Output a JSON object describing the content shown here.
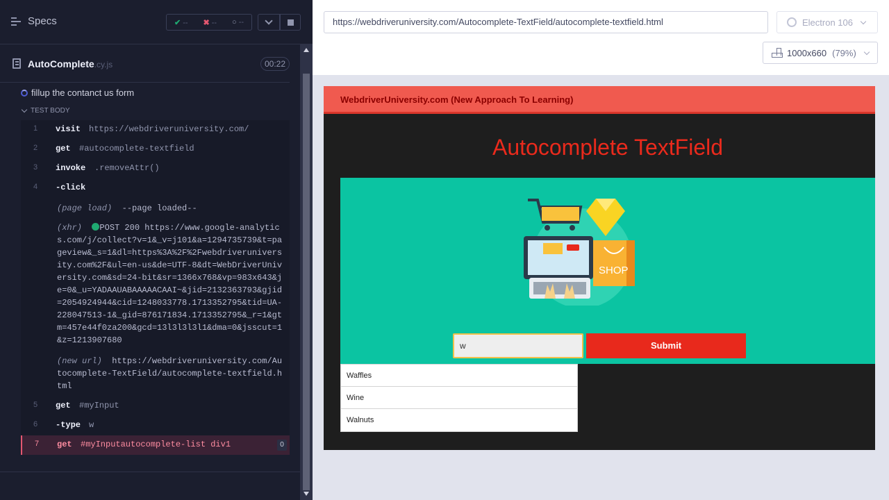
{
  "reporter": {
    "specs_label": "Specs",
    "stats": {
      "passed": "--",
      "failed": "--",
      "pending": "--"
    },
    "file": {
      "name": "AutoComplete",
      "ext": ".cy.js",
      "duration": "00:22"
    },
    "test_title": "fillup the contanct us form",
    "test_body_label": "TEST BODY",
    "commands": [
      {
        "num": "1",
        "name": "visit",
        "arg": "https://webdriveruniversity.com/"
      },
      {
        "num": "2",
        "name": "get",
        "arg": "#autocomplete-textfield"
      },
      {
        "num": "3",
        "name": "invoke",
        "arg": ".removeAttr()"
      },
      {
        "num": "4",
        "name": "-click",
        "arg": ""
      },
      {
        "num": "5",
        "name": "get",
        "arg": "#myInput"
      },
      {
        "num": "6",
        "name": "-type",
        "arg": "w"
      },
      {
        "num": "7",
        "name": "get",
        "arg": "#myInputautocomplete-list div1",
        "badge": "0"
      }
    ],
    "page_load": {
      "label": "(page load)",
      "text": "--page loaded--"
    },
    "xhr": {
      "label": "(xhr)",
      "text": "POST 200 https://www.google-analytics.com/j/collect?v=1&_v=j101&a=1294735739&t=pageview&_s=1&dl=https%3A%2F%2Fwebdriveruniversity.com%2F&ul=en-us&de=UTF-8&dt=WebDriverUniversity.com&sd=24-bit&sr=1366x768&vp=983x643&je=0&_u=YADAAUABAAAAACAAI~&jid=2132363793&gjid=2054924944&cid=1248033778.1713352795&tid=UA-228047513-1&_gid=876171834.1713352795&_r=1&gtm=457e44f0za200&gcd=13l3l3l3l1&dma=0&jsscut=1&z=1213907680"
    },
    "new_url": {
      "label": "(new url)",
      "text": "https://webdriveruniversity.com/Autocomplete-TextField/autocomplete-textfield.html"
    }
  },
  "browser": {
    "url": "https://webdriveruniversity.com/Autocomplete-TextField/autocomplete-textfield.html",
    "browser_name": "Electron 106",
    "viewport": "1000x660",
    "zoom": "(79%)"
  },
  "site": {
    "brand": "WebdriverUniversity.com (New Approach To Learning)",
    "title": "Autocomplete TextField",
    "input_value": "w",
    "submit_label": "Submit",
    "suggestions": [
      "Waffles",
      "Wine",
      "Walnuts"
    ],
    "colors": {
      "header": "#f05a4f",
      "title": "#ea2a1c",
      "panel": "#0bc4a2",
      "submit": "#e8291c"
    }
  }
}
